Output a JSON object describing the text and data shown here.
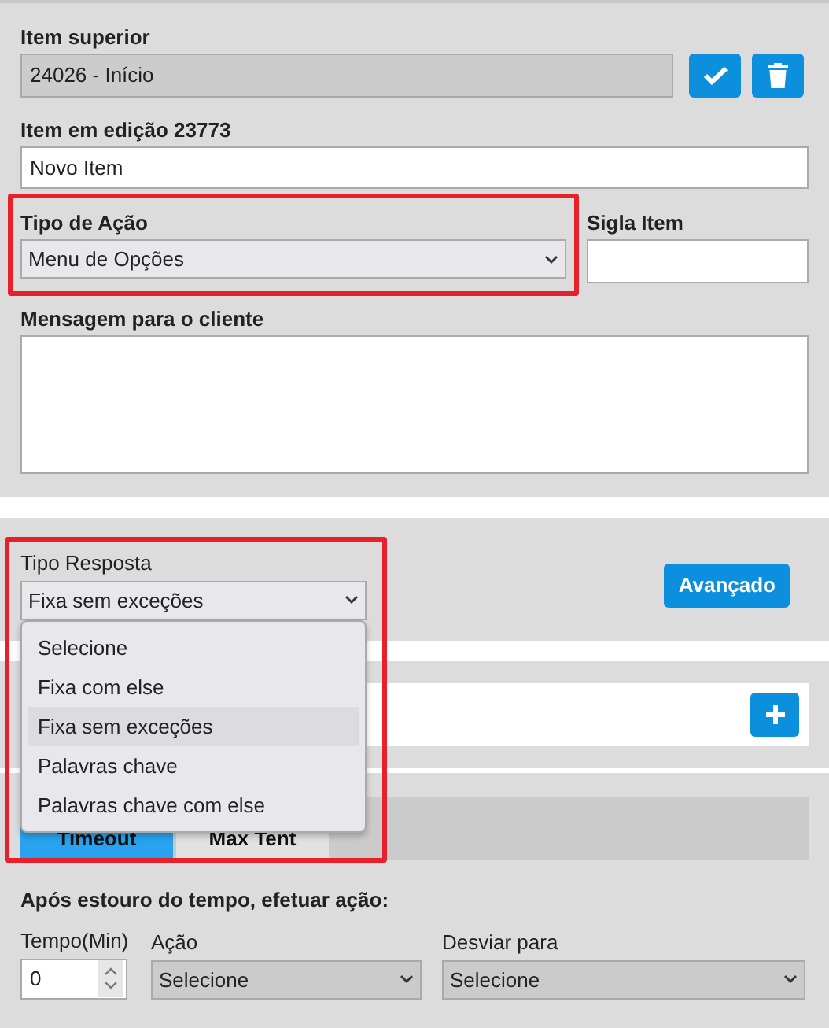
{
  "item_superior": {
    "label": "Item superior",
    "value": "24026 - Início",
    "disabled": true
  },
  "toolbar_buttons": [
    {
      "kind": "confirm"
    },
    {
      "kind": "delete"
    }
  ],
  "item_edicao": {
    "label": "Item em edição **23773**",
    "value": "Novo Item"
  },
  "tipo_acao": {
    "label": "Tipo de Ação",
    "value": "Menu de Opções",
    "highlighted": true
  },
  "sigla_item": {
    "label": "Sigla Item"
  },
  "mensagem": {
    "label": "Mensagem para o cliente"
  },
  "tipo_resposta": {
    "label": "Tipo Resposta",
    "value": "Fixa sem exceções",
    "expanded": true,
    "highlighted": true,
    "options": [
      {
        "label": "Selecione",
        "selected": false
      },
      {
        "label": "Fixa com else",
        "selected": false
      },
      {
        "label": "Fixa sem exceções",
        "selected": true
      },
      {
        "label": "Palavras chave",
        "selected": false
      },
      {
        "label": "Palavras chave com else",
        "selected": false
      }
    ]
  },
  "advanced_button": "Avançado",
  "add_row": {
    "kind": "add"
  },
  "tabs": [
    {
      "label": "Timeout",
      "selected": true
    },
    {
      "label": "Max Tent",
      "selected": false
    }
  ],
  "timeout_section": {
    "title": "Após estouro do tempo, efetuar ação:",
    "fields": [
      {
        "kind": "number",
        "label": "Tempo(Min)",
        "value": "0"
      },
      {
        "kind": "select",
        "label": "Ação",
        "value": "Selecione"
      },
      {
        "kind": "select",
        "label": "Desviar para",
        "value": "Selecione"
      }
    ]
  }
}
